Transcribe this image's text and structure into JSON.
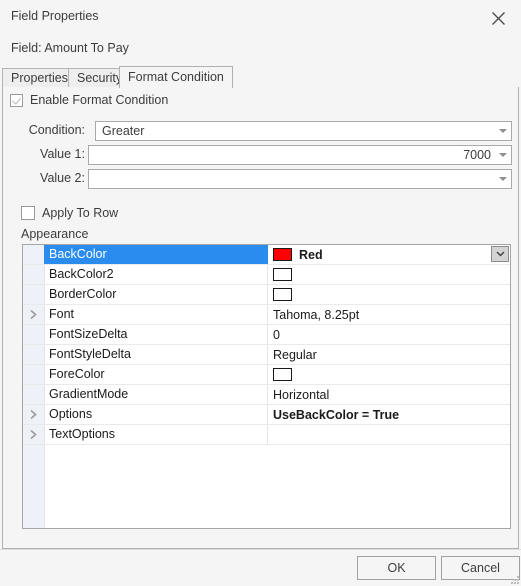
{
  "window": {
    "title": "Field Properties",
    "close_icon": "close-icon",
    "field_label": "Field: Amount To Pay"
  },
  "tabs": [
    {
      "label": "Properties",
      "active": false
    },
    {
      "label": "Security",
      "active": false
    },
    {
      "label": "Format Condition",
      "active": true
    }
  ],
  "format_condition": {
    "enable": {
      "label": "Enable Format Condition",
      "checked": true
    },
    "condition": {
      "label": "Condition:",
      "value": "Greater",
      "placeholder": ""
    },
    "value1": {
      "label": "Value 1:",
      "value": "7000",
      "placeholder": ""
    },
    "value2": {
      "label": "Value 2:",
      "value": "",
      "placeholder": ""
    },
    "apply_to_row": {
      "label": "Apply To Row",
      "checked": false
    },
    "appearance": {
      "group_label": "Appearance",
      "selected_row": "BackColor",
      "rows": [
        {
          "name": "BackColor",
          "value": "Red",
          "kind": "color",
          "swatch": "#FF0000",
          "expandable": false,
          "bold": true,
          "selected": true,
          "has_dropdown": true
        },
        {
          "name": "BackColor2",
          "value": "",
          "kind": "color",
          "swatch": "#FFFFFF",
          "expandable": false,
          "bold": false,
          "selected": false,
          "has_dropdown": false
        },
        {
          "name": "BorderColor",
          "value": "",
          "kind": "color",
          "swatch": "#FFFFFF",
          "expandable": false,
          "bold": false,
          "selected": false,
          "has_dropdown": false
        },
        {
          "name": "Font",
          "value": "Tahoma, 8.25pt",
          "kind": "text",
          "swatch": "",
          "expandable": true,
          "bold": false,
          "selected": false,
          "has_dropdown": false
        },
        {
          "name": "FontSizeDelta",
          "value": "0",
          "kind": "text",
          "swatch": "",
          "expandable": false,
          "bold": false,
          "selected": false,
          "has_dropdown": false
        },
        {
          "name": "FontStyleDelta",
          "value": "Regular",
          "kind": "text",
          "swatch": "",
          "expandable": false,
          "bold": false,
          "selected": false,
          "has_dropdown": false
        },
        {
          "name": "ForeColor",
          "value": "",
          "kind": "color",
          "swatch": "#FFFFFF",
          "expandable": false,
          "bold": false,
          "selected": false,
          "has_dropdown": false
        },
        {
          "name": "GradientMode",
          "value": "Horizontal",
          "kind": "text",
          "swatch": "",
          "expandable": false,
          "bold": false,
          "selected": false,
          "has_dropdown": false
        },
        {
          "name": "Options",
          "value": "UseBackColor = True",
          "kind": "text",
          "swatch": "",
          "expandable": true,
          "bold": true,
          "selected": false,
          "has_dropdown": false
        },
        {
          "name": "TextOptions",
          "value": "",
          "kind": "text",
          "swatch": "",
          "expandable": true,
          "bold": false,
          "selected": false,
          "has_dropdown": false
        }
      ]
    }
  },
  "footer": {
    "ok_label": "OK",
    "cancel_label": "Cancel"
  },
  "colors": {
    "selection_blue": "#2b8cf0",
    "backcolor_red": "#FF0000",
    "dialog_bg": "#f5f5f5",
    "border": "#b0b0b0"
  }
}
